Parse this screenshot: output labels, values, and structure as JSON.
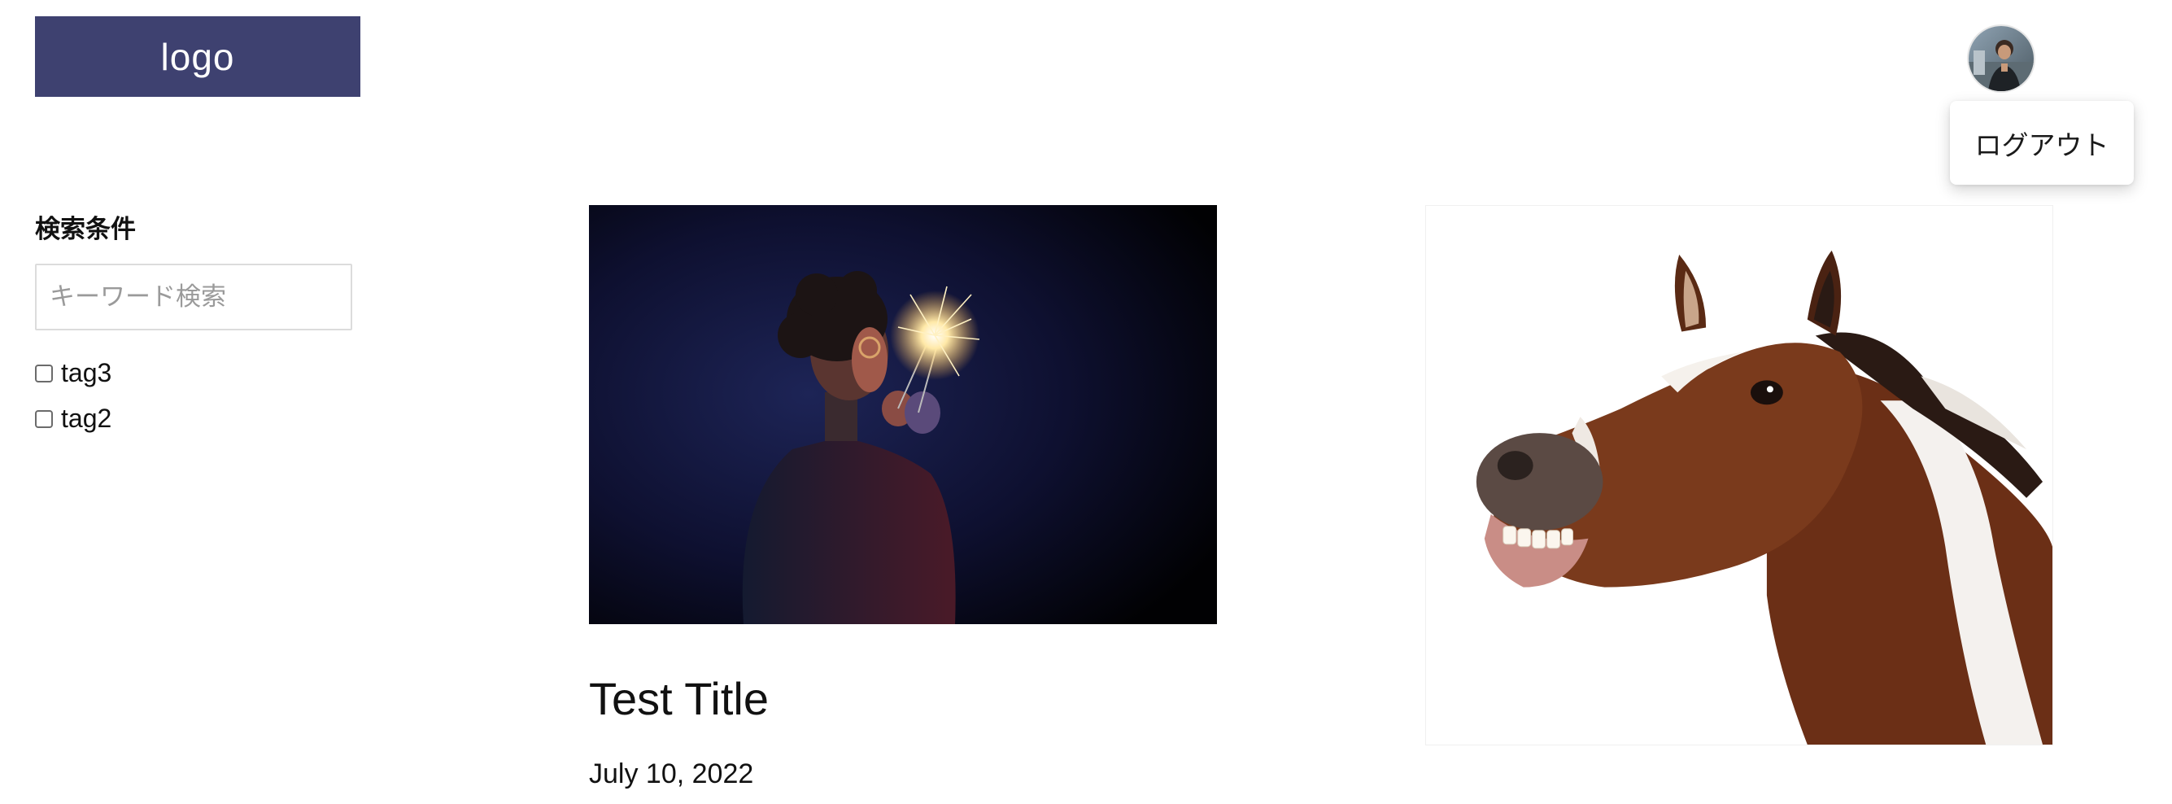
{
  "header": {
    "logo_text": "logo",
    "avatar_icon": "user-avatar-photo"
  },
  "user_menu": {
    "items": [
      {
        "label": "ログアウト"
      }
    ]
  },
  "sidebar": {
    "title": "検索条件",
    "search": {
      "placeholder": "キーワード検索",
      "value": ""
    },
    "tags": [
      {
        "label": "tag3",
        "checked": false
      },
      {
        "label": "tag2",
        "checked": false
      }
    ]
  },
  "cards": [
    {
      "title": "Test Title",
      "date": "July 10, 2022",
      "image": "person-holding-sparklers-photo"
    },
    {
      "image": "horse-grinning-photo"
    }
  ],
  "colors": {
    "logo_bg": "#3e4170",
    "logo_text": "#ffffff",
    "background": "#ffffff"
  }
}
